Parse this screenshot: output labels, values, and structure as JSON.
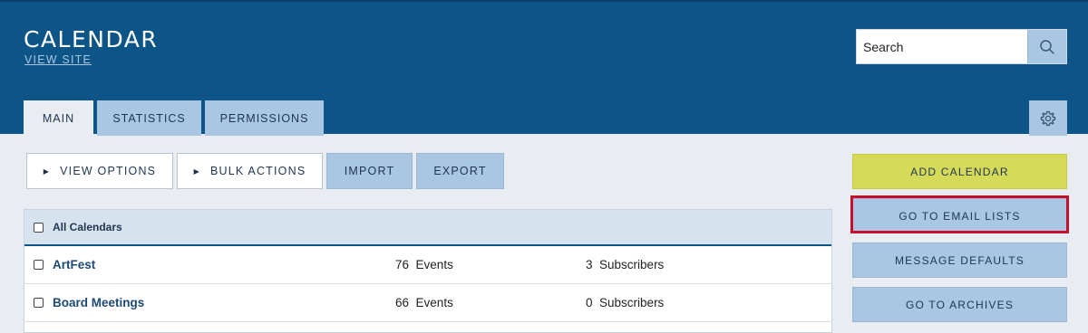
{
  "header": {
    "title": "CALENDAR",
    "view_site": "VIEW SITE",
    "search_placeholder": "Search"
  },
  "tabs": [
    {
      "label": "MAIN",
      "active": true
    },
    {
      "label": "STATISTICS",
      "active": false
    },
    {
      "label": "PERMISSIONS",
      "active": false
    }
  ],
  "toolbar": {
    "view_options": "VIEW OPTIONS",
    "bulk_actions": "BULK ACTIONS",
    "import": "IMPORT",
    "export": "EXPORT"
  },
  "table": {
    "header_label": "All Calendars",
    "rows": [
      {
        "name": "ArtFest",
        "events_count": "76",
        "events_label": "Events",
        "subscribers_count": "3",
        "subscribers_label": "Subscribers"
      },
      {
        "name": "Board Meetings",
        "events_count": "66",
        "events_label": "Events",
        "subscribers_count": "0",
        "subscribers_label": "Subscribers"
      }
    ]
  },
  "sidebar_actions": {
    "add_calendar": "ADD CALENDAR",
    "go_to_email_lists": "GO TO EMAIL LISTS",
    "message_defaults": "MESSAGE DEFAULTS",
    "go_to_archives": "GO TO ARCHIVES"
  },
  "icons": {
    "search": "search-icon",
    "settings": "gear-icon",
    "expand": "triangle-right-icon"
  },
  "colors": {
    "header_bg": "#0d5487",
    "button_blue": "#a9c6e2",
    "add_button_yellow": "#d6da5a",
    "highlight_red": "#c4102b",
    "page_bg": "#e9edf1"
  }
}
